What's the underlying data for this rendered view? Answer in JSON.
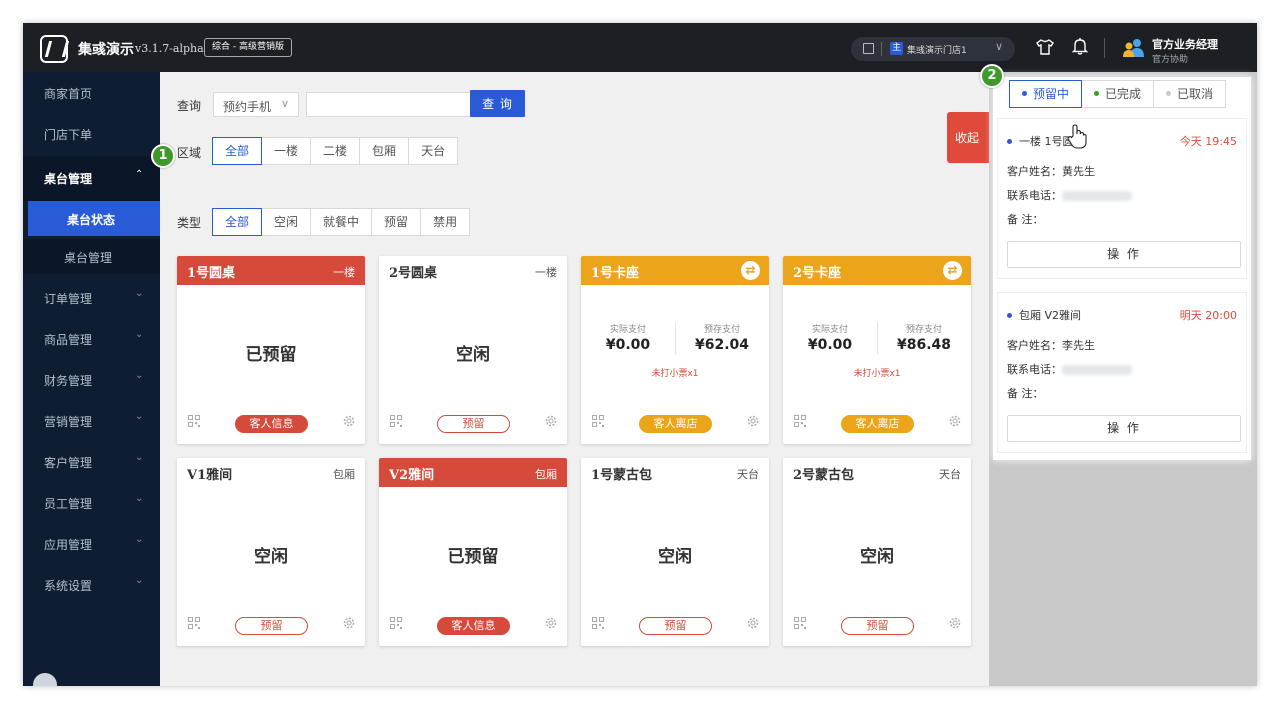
{
  "topbar": {
    "app_name": "集彧演示",
    "version": "v3.1.7-alpha",
    "edition": "综合 - 高级营销版",
    "store_badge": "主",
    "store_name": "集彧演示门店1",
    "user_name": "官方业务经理",
    "user_role": "官方协助"
  },
  "sidebar": {
    "items": [
      {
        "label": "商家首页"
      },
      {
        "label": "门店下单"
      },
      {
        "label": "桌台管理"
      },
      {
        "label": "订单管理"
      },
      {
        "label": "商品管理"
      },
      {
        "label": "财务管理"
      },
      {
        "label": "营销管理"
      },
      {
        "label": "客户管理"
      },
      {
        "label": "员工管理"
      },
      {
        "label": "应用管理"
      },
      {
        "label": "系统设置"
      }
    ],
    "sub_items": [
      {
        "label": "桌台状态"
      },
      {
        "label": "桌台管理"
      }
    ]
  },
  "filters": {
    "query_label": "查询",
    "query_type": "预约手机",
    "query_button": "查 询",
    "area_label": "区域",
    "area_options": [
      "全部",
      "一楼",
      "二楼",
      "包厢",
      "天台"
    ],
    "type_label": "类型",
    "type_options": [
      "全部",
      "空闲",
      "就餐中",
      "预留",
      "禁用"
    ],
    "collapse": "收起"
  },
  "cards": [
    {
      "name": "1号圆桌",
      "area": "一楼",
      "status": "已预留",
      "action": "客人信息"
    },
    {
      "name": "2号圆桌",
      "area": "一楼",
      "status": "空闲",
      "action": "预留"
    },
    {
      "name": "1号卡座",
      "paid_label": "实际支付",
      "paid": "¥0.00",
      "prepay_label": "预存支付",
      "prepay": "¥62.04",
      "unprinted": "未打小票x1",
      "action": "客人离店"
    },
    {
      "name": "2号卡座",
      "paid_label": "实际支付",
      "paid": "¥0.00",
      "prepay_label": "预存支付",
      "prepay": "¥86.48",
      "unprinted": "未打小票x1",
      "action": "客人离店"
    },
    {
      "name": "V1雅间",
      "area": "包厢",
      "status": "空闲",
      "action": "预留"
    },
    {
      "name": "V2雅间",
      "area": "包厢",
      "status": "已预留",
      "action": "客人信息"
    },
    {
      "name": "1号蒙古包",
      "area": "天台",
      "status": "空闲",
      "action": "预留"
    },
    {
      "name": "2号蒙古包",
      "area": "天台",
      "status": "空闲",
      "action": "预留"
    }
  ],
  "reservation_panel": {
    "tabs": [
      "预留中",
      "已完成",
      "已取消"
    ],
    "items": [
      {
        "table": "一楼 1号圆桌",
        "time": "今天 19:45",
        "customer_label": "客户姓名：",
        "customer": "黄先生",
        "phone_label": "联系电话：",
        "note_label": "备 注：",
        "action": "操 作"
      },
      {
        "table": "包厢 V2雅间",
        "time": "明天 20:00",
        "customer_label": "客户姓名：",
        "customer": "李先生",
        "phone_label": "联系电话：",
        "note_label": "备 注：",
        "action": "操 作"
      }
    ]
  },
  "markers": [
    "1",
    "2"
  ],
  "colors": {
    "primary": "#2a5bd7",
    "danger": "#d64a3b",
    "warning": "#eca51b",
    "success": "#3f9a2a",
    "sidebar": "#0f1d33",
    "topbar": "#1c1f24"
  }
}
